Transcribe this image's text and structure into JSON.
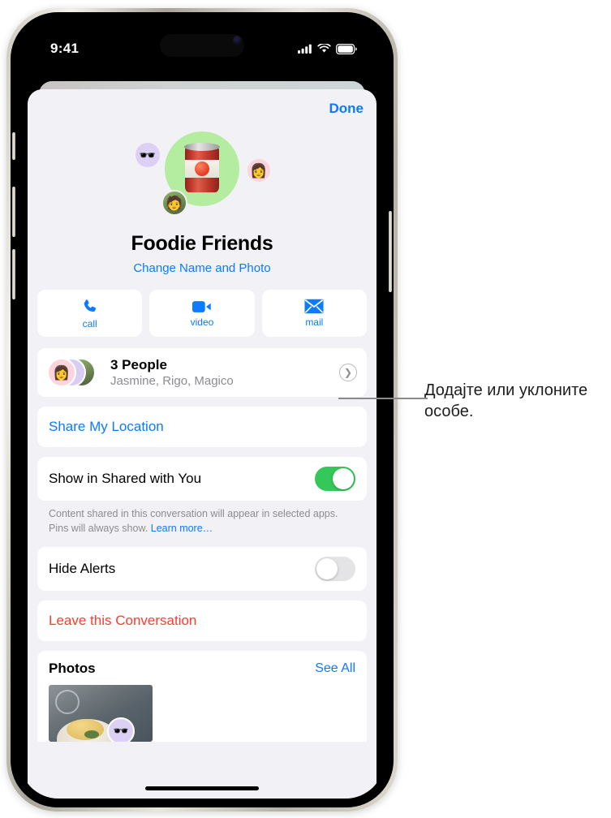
{
  "status_bar": {
    "time": "9:41",
    "icons": [
      "cellular-signal-icon",
      "wifi-icon",
      "battery-icon"
    ]
  },
  "sheet": {
    "done_label": "Done"
  },
  "group": {
    "title": "Foodie Friends",
    "change_link": "Change Name and Photo",
    "avatar_icon": "tomato-can-emoji",
    "avatar_bg": "#b5eda0",
    "member_avatars": [
      "memoji-sunglasses",
      "memoji-glasses",
      "photo-avatar"
    ]
  },
  "actions": [
    {
      "label": "call",
      "icon": "phone-icon"
    },
    {
      "label": "video",
      "icon": "video-camera-icon"
    },
    {
      "label": "mail",
      "icon": "envelope-icon"
    }
  ],
  "people": {
    "title": "3 People",
    "subtitle": "Jasmine, Rigo, Magico",
    "chevron": "chevron-right-icon"
  },
  "share_location": {
    "label": "Share My Location"
  },
  "shared_with_you": {
    "label": "Show in Shared with You",
    "enabled": true,
    "footnote": "Content shared in this conversation will appear in selected apps. Pins will always show.",
    "learn_more": "Learn more…"
  },
  "hide_alerts": {
    "label": "Hide Alerts",
    "enabled": false
  },
  "leave": {
    "label": "Leave this Conversation"
  },
  "photos": {
    "title": "Photos",
    "see_all": "See All"
  },
  "callout": {
    "text": "Додајте или уклоните особе."
  },
  "colors": {
    "accent_blue": "#0b7bff",
    "destructive_red": "#ff3b30",
    "toggle_on_green": "#34c759",
    "sheet_background": "#f2f1f6",
    "card_background": "#ffffff",
    "secondary_text": "#8c8c90"
  }
}
